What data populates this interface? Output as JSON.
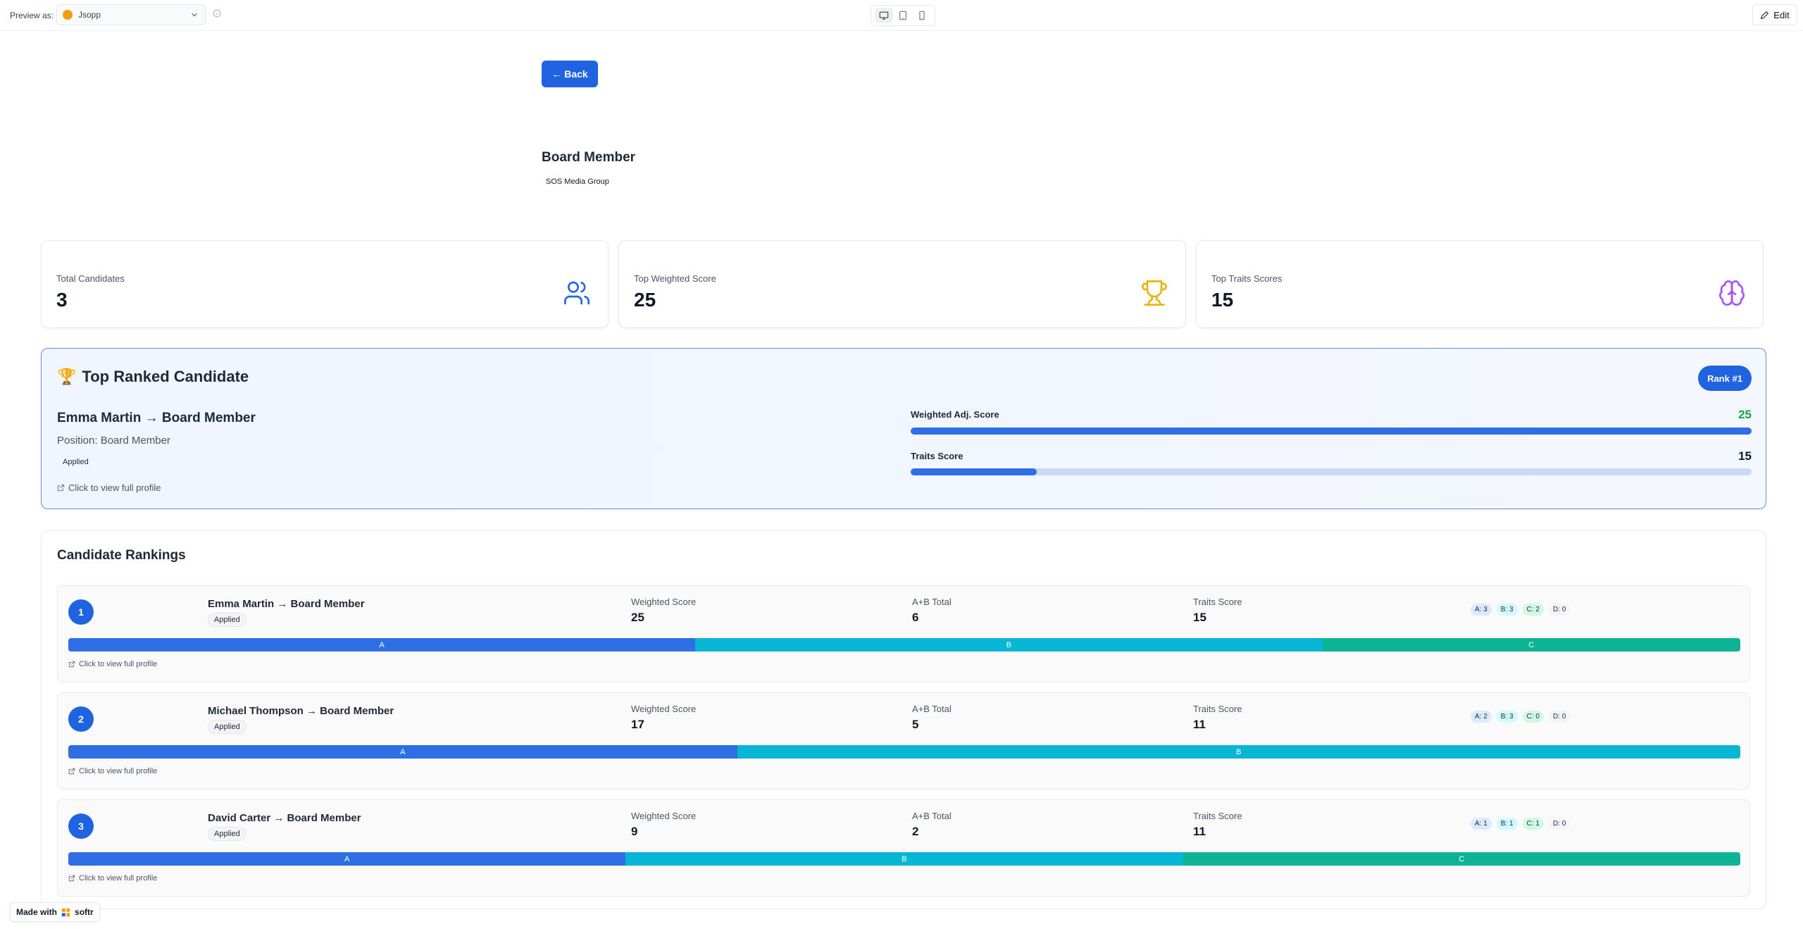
{
  "topbar": {
    "preview_label": "Preview as:",
    "selected_user": "Jsopp",
    "edit_label": "Edit"
  },
  "header": {
    "back_label": "← Back",
    "job_title": "Board Member",
    "company": "SOS Media Group"
  },
  "stats": [
    {
      "label": "Total Candidates",
      "value": "3",
      "icon": "users-icon",
      "color": "#2563eb"
    },
    {
      "label": "Top Weighted Score",
      "value": "25",
      "icon": "trophy-icon",
      "color": "#eab308"
    },
    {
      "label": "Top Traits Scores",
      "value": "15",
      "icon": "brain-icon",
      "color": "#a855f7"
    }
  ],
  "top_candidate": {
    "heading": "Top Ranked Candidate",
    "emoji": "🏆",
    "rank_label": "Rank #1",
    "name": "Emma Martin → Board Member",
    "position": "Position: Board Member",
    "status": "Applied",
    "link": "Click to view full profile",
    "weighted_label": "Weighted Adj. Score",
    "weighted_value": "25",
    "weighted_fraction": 1.0,
    "traits_label": "Traits Score",
    "traits_value": "15",
    "traits_fraction": 0.15
  },
  "rankings": {
    "heading": "Candidate Rankings",
    "metric_labels": {
      "weighted": "Weighted Score",
      "ab": "A+B Total",
      "traits": "Traits Score"
    },
    "items": [
      {
        "rank": "1",
        "name": "Emma Martin → Board Member",
        "status": "Applied",
        "weighted": "25",
        "ab": "6",
        "traits": "15",
        "chips": {
          "a": "A: 3",
          "b": "B: 3",
          "c": "C: 2",
          "d": "D: 0"
        },
        "segments": [
          {
            "label": "A",
            "count": 3
          },
          {
            "label": "B",
            "count": 3
          },
          {
            "label": "C",
            "count": 2
          }
        ],
        "link": "Click to view full profile"
      },
      {
        "rank": "2",
        "name": "Michael Thompson → Board Member",
        "status": "Applied",
        "weighted": "17",
        "ab": "5",
        "traits": "11",
        "chips": {
          "a": "A: 2",
          "b": "B: 3",
          "c": "C: 0",
          "d": "D: 0"
        },
        "segments": [
          {
            "label": "A",
            "count": 2
          },
          {
            "label": "B",
            "count": 3
          }
        ],
        "link": "Click to view full profile"
      },
      {
        "rank": "3",
        "name": "David Carter → Board Member",
        "status": "Applied",
        "weighted": "9",
        "ab": "2",
        "traits": "11",
        "chips": {
          "a": "A: 1",
          "b": "B: 1",
          "c": "C: 1",
          "d": "D: 0"
        },
        "segments": [
          {
            "label": "A",
            "count": 1
          },
          {
            "label": "B",
            "count": 1
          },
          {
            "label": "C",
            "count": 1
          }
        ],
        "link": "Click to view full profile"
      }
    ]
  },
  "footer": {
    "made_with": "Made with",
    "brand": "softr"
  }
}
